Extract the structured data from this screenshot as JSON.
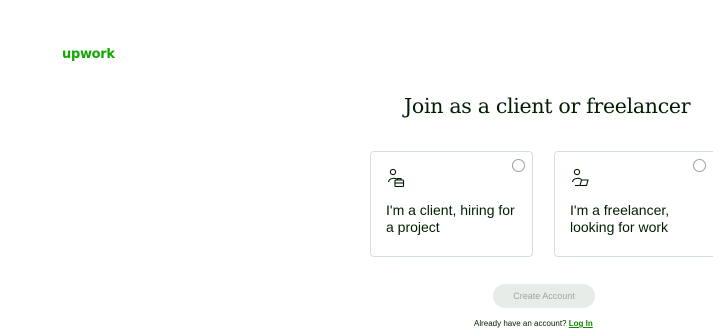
{
  "brand": {
    "logo_text": "upwork",
    "accent_color": "#14a800"
  },
  "heading": "Join as a client or freelancer",
  "options": [
    {
      "id": "client",
      "icon": "client-briefcase-icon",
      "label": "I'm a client, hiring for a project",
      "selected": false
    },
    {
      "id": "freelancer",
      "icon": "freelancer-laptop-icon",
      "label": "I'm a freelancer, looking for work",
      "selected": false
    }
  ],
  "create_button": {
    "label": "Create Account",
    "disabled": true
  },
  "login": {
    "prompt": "Already have an account?",
    "link_label": "Log In"
  }
}
